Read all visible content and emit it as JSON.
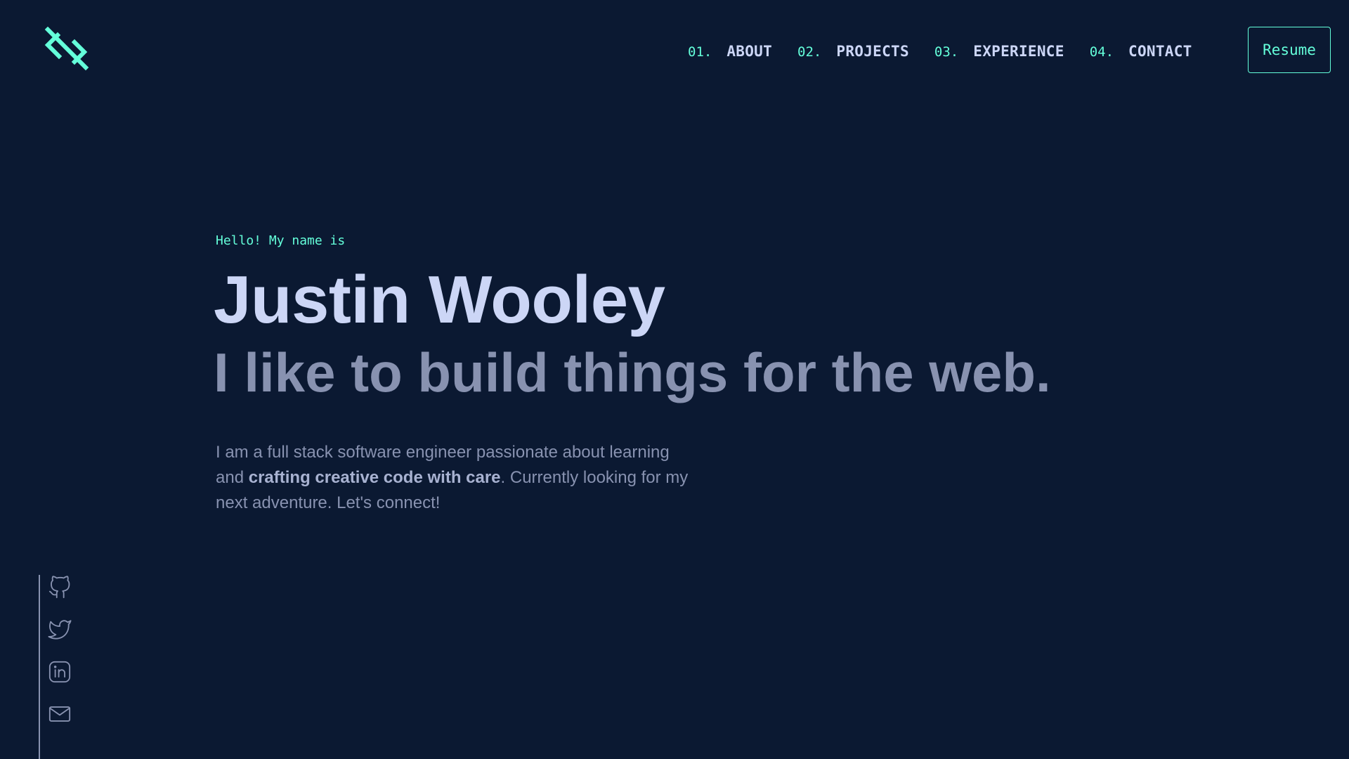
{
  "brand": {
    "logo_icon": "logo-monogram-icon",
    "accent_color": "#64ffda",
    "background_color": "#0b1932"
  },
  "nav": {
    "items": [
      {
        "number": "01.",
        "label": "ABOUT"
      },
      {
        "number": "02.",
        "label": "PROJECTS"
      },
      {
        "number": "03.",
        "label": "EXPERIENCE"
      },
      {
        "number": "04.",
        "label": "CONTACT"
      }
    ],
    "resume_label": "Resume"
  },
  "hero": {
    "greeting": "Hello! My name is",
    "name": "Justin Wooley",
    "tagline": "I like to build things for the web.",
    "bio_before": "I am a full stack software engineer passionate about learning and ",
    "bio_emphasis": "crafting creative code with care",
    "bio_after": ". Currently looking for my next adventure. Let's connect!"
  },
  "social": {
    "icons": [
      "github-icon",
      "twitter-icon",
      "linkedin-icon",
      "email-icon"
    ]
  }
}
